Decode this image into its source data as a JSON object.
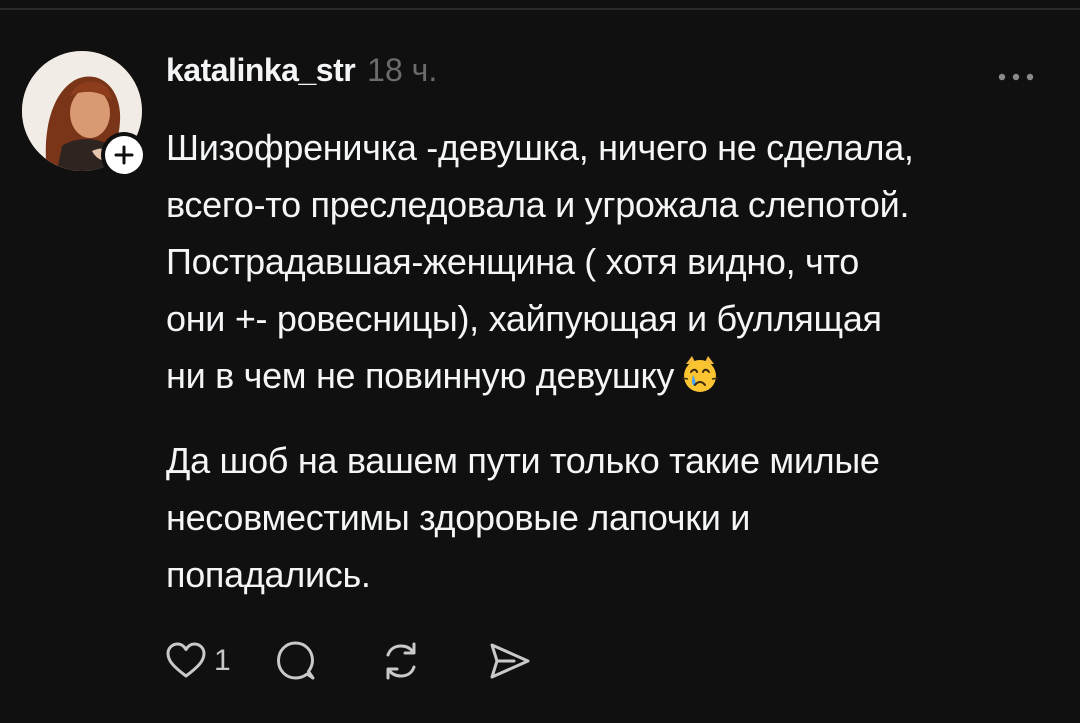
{
  "post": {
    "username": "katalinka_str",
    "timestamp": "18 ч.",
    "paragraph1": "Шизофреничка -девушка, ничего не сделала,\nвсего-то преследовала и угрожала слепотой.\nПострадавшая-женщина ( хотя видно, что\nони +- ровесницы), хайпующая и буллящая\nни в чем не повинную девушку",
    "paragraph1_emoji": "crying-cat-emoji",
    "paragraph2": "Да шоб на вашем пути только такие милые\nнесовместимы здоровые лапочки и\nпопадались.",
    "like_count": "1"
  },
  "icons": {
    "more": "more-horizontal-icon",
    "follow": "plus-icon",
    "like": "heart-icon",
    "reply": "comment-bubble-icon",
    "repost": "repost-icon",
    "share": "send-icon"
  },
  "colors": {
    "background": "#101010",
    "text": "#f3f5f7",
    "muted": "#6c6c6c"
  }
}
